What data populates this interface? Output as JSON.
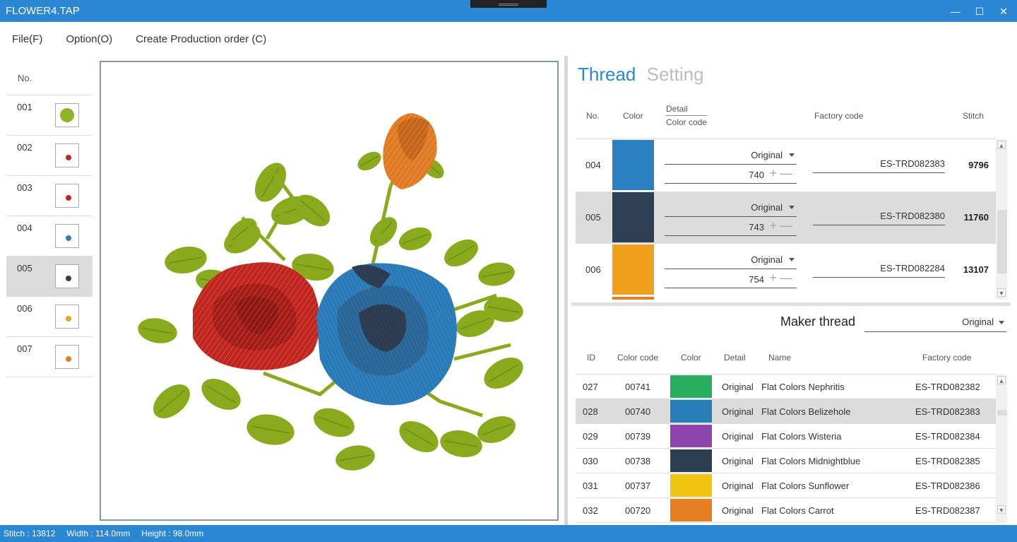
{
  "window": {
    "title": "FLOWER4.TAP",
    "minimize_glyph": "—",
    "maximize_glyph": "☐",
    "close_glyph": "✕"
  },
  "menu": {
    "file": "File(F)",
    "option": "Option(O)",
    "production": "Create Production order (C)"
  },
  "layers": {
    "header": "No.",
    "items": [
      {
        "no": "001",
        "thumb_color": "#8db52a"
      },
      {
        "no": "002",
        "thumb_color": "#c0261e"
      },
      {
        "no": "003",
        "thumb_color": "#c0261e"
      },
      {
        "no": "004",
        "thumb_color": "#2e7fbe"
      },
      {
        "no": "005",
        "thumb_color": "#2f3e53"
      },
      {
        "no": "006",
        "thumb_color": "#f1a218"
      },
      {
        "no": "007",
        "thumb_color": "#e47a24"
      }
    ],
    "selected_index": 4
  },
  "tabs": {
    "thread": "Thread",
    "setting": "Setting"
  },
  "thread_table": {
    "headers": {
      "no": "No.",
      "color": "Color",
      "detail": "Detail",
      "color_code": "Color code",
      "factory_code": "Factory code",
      "stitch": "Stitch"
    },
    "rows": [
      {
        "no": "004",
        "color": "#2b80c0",
        "detail": "Original",
        "color_code": "740",
        "factory_code": "ES-TRD082383",
        "stitch": "9796"
      },
      {
        "no": "005",
        "color": "#2e3e53",
        "detail": "Original",
        "color_code": "743",
        "factory_code": "ES-TRD082380",
        "stitch": "11760"
      },
      {
        "no": "006",
        "color": "#f0a01a",
        "detail": "Original",
        "color_code": "754",
        "factory_code": "ES-TRD082284",
        "stitch": "13107"
      }
    ],
    "selected_index": 1,
    "peek_color": "#e67e22",
    "plus_glyph": "+",
    "minus_glyph": "—"
  },
  "maker": {
    "label": "Maker thread",
    "value": "Original"
  },
  "maker_table": {
    "headers": {
      "id": "ID",
      "color_code": "Color code",
      "color": "Color",
      "detail": "Detail",
      "name": "Name",
      "factory_code": "Factory code"
    },
    "rows": [
      {
        "id": "027",
        "color_code": "00741",
        "color": "#27ae60",
        "detail": "Original",
        "name": "Flat Colors Nephritis",
        "factory_code": "ES-TRD082382"
      },
      {
        "id": "028",
        "color_code": "00740",
        "color": "#2980b9",
        "detail": "Original",
        "name": "Flat Colors Belizehole",
        "factory_code": "ES-TRD082383"
      },
      {
        "id": "029",
        "color_code": "00739",
        "color": "#8e44ad",
        "detail": "Original",
        "name": "Flat Colors Wisteria",
        "factory_code": "ES-TRD082384"
      },
      {
        "id": "030",
        "color_code": "00738",
        "color": "#2c3e50",
        "detail": "Original",
        "name": "Flat Colors Midnightblue",
        "factory_code": "ES-TRD082385"
      },
      {
        "id": "031",
        "color_code": "00737",
        "color": "#f1c40f",
        "detail": "Original",
        "name": "Flat Colors Sunflower",
        "factory_code": "ES-TRD082386"
      },
      {
        "id": "032",
        "color_code": "00720",
        "color": "#e67e22",
        "detail": "Original",
        "name": "Flat Colors Carrot",
        "factory_code": "ES-TRD082387"
      }
    ],
    "selected_index": 1
  },
  "scroll": {
    "up_glyph": "▲",
    "down_glyph": "▼"
  },
  "status": {
    "stitch": "Stitch : 13812",
    "width": "Width : 114.0mm",
    "height": "Height : 98.0mm"
  },
  "colors": {
    "accent": "#2b87d3",
    "leaf": "#8aaa1e",
    "rose_red": "#c0261e",
    "rose_blue": "#2e7fbe",
    "rose_dark": "#2f3e53",
    "bud_orange": "#e07a22"
  }
}
